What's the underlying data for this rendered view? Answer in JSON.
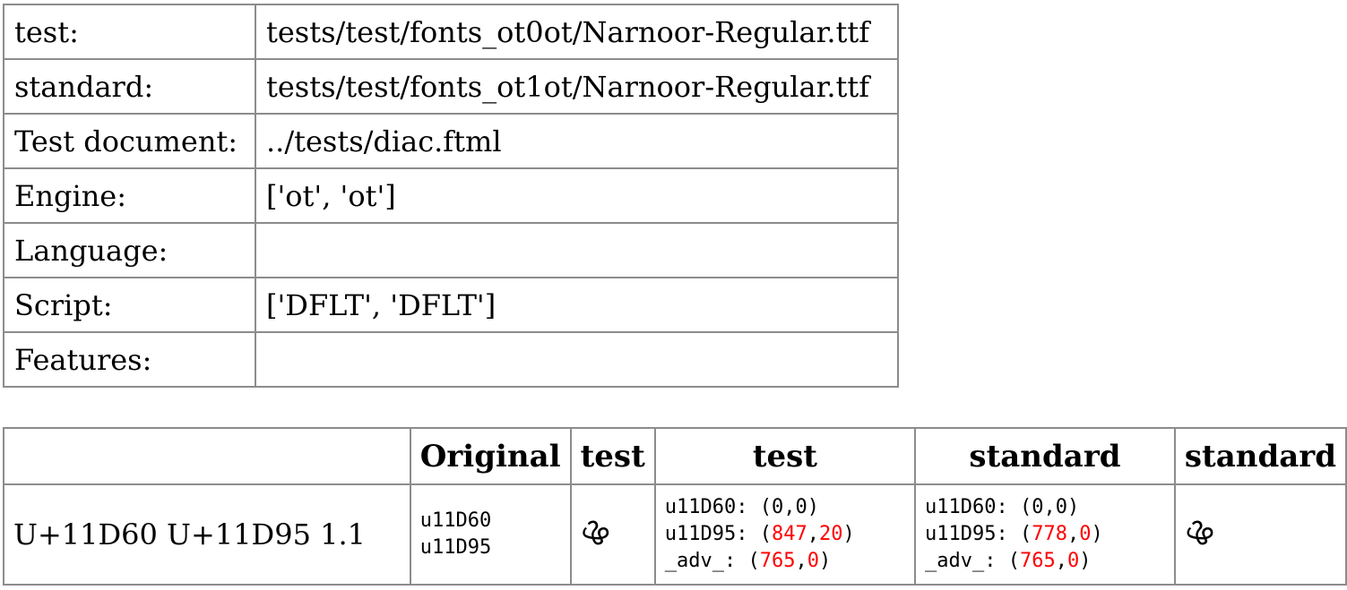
{
  "meta": {
    "rows": [
      {
        "key": "test:",
        "value": "tests/test/fonts_ot0ot/Narnoor-Regular.ttf"
      },
      {
        "key": "standard:",
        "value": "tests/test/fonts_ot1ot/Narnoor-Regular.ttf"
      },
      {
        "key": "Test document:",
        "value": "../tests/diac.ftml"
      },
      {
        "key": "Engine:",
        "value": "['ot', 'ot']"
      },
      {
        "key": "Language:",
        "value": ""
      },
      {
        "key": "Script:",
        "value": "['DFLT', 'DFLT']"
      },
      {
        "key": "Features:",
        "value": ""
      }
    ]
  },
  "results": {
    "headers": [
      "",
      "Original",
      "test",
      "test",
      "standard",
      "standard"
    ],
    "row": {
      "label": "U+11D60 U+11D95 1.1",
      "original": [
        "u11D60",
        "u11D95"
      ],
      "test_glyph": "ൖ",
      "test_positions": [
        {
          "name": "u11D60",
          "x": "0",
          "y": "0",
          "x_diff": false,
          "y_diff": false
        },
        {
          "name": "u11D95",
          "x": "847",
          "y": "20",
          "x_diff": true,
          "y_diff": true
        },
        {
          "name": "_adv_",
          "x": "765",
          "y": "0",
          "x_diff": true,
          "y_diff": true
        }
      ],
      "standard_positions": [
        {
          "name": "u11D60",
          "x": "0",
          "y": "0",
          "x_diff": false,
          "y_diff": false
        },
        {
          "name": "u11D95",
          "x": "778",
          "y": "0",
          "x_diff": true,
          "y_diff": true
        },
        {
          "name": "_adv_",
          "x": "765",
          "y": "0",
          "x_diff": true,
          "y_diff": true
        }
      ],
      "standard_glyph": "ൖ"
    }
  }
}
